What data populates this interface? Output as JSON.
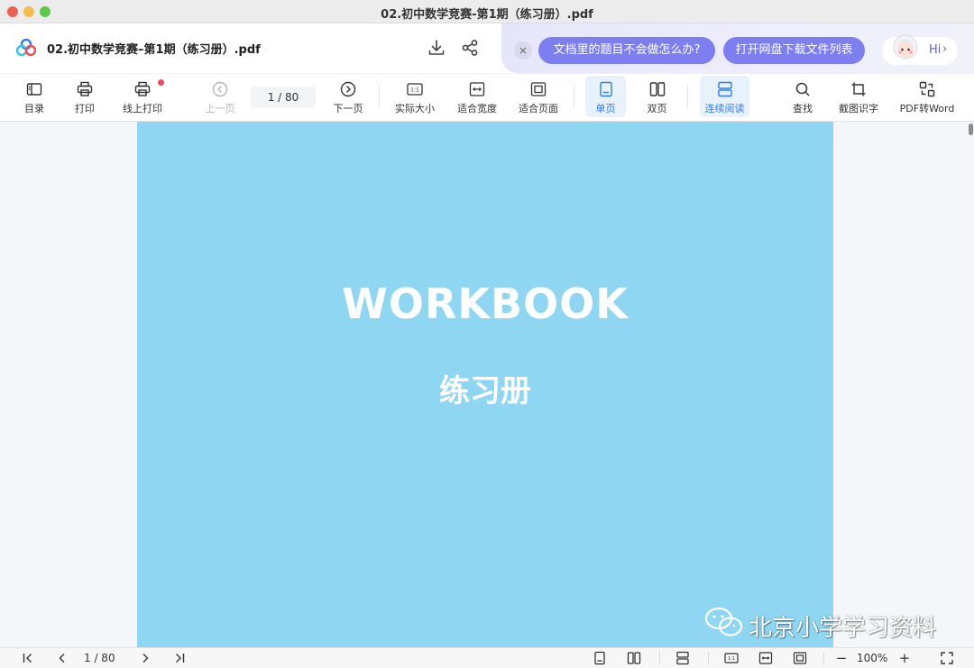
{
  "window": {
    "title": "02.初中数学竞赛-第1期（练习册）.pdf"
  },
  "header": {
    "doc_title": "02.初中数学竞赛–第1期（练习册）.pdf",
    "promo_1": "文档里的题目不会做怎么办?",
    "promo_2": "打开网盘下载文件列表",
    "hi": "Hi",
    "close": "×"
  },
  "toolbar": {
    "toc": "目录",
    "print": "打印",
    "online_print": "线上打印",
    "prev_page": "上一页",
    "page_current": "1",
    "page_total": "80",
    "page_display": "1  / 80",
    "next_page": "下一页",
    "actual_size": "实际大小",
    "fit_width": "适合宽度",
    "fit_page": "适合页面",
    "single_page": "单页",
    "double_page": "双页",
    "continuous": "连续阅读",
    "find": "查找",
    "ocr": "截图识字",
    "pdf_to_word": "PDF转Word"
  },
  "document": {
    "title_en": "WORKBOOK",
    "title_cn": "练习册",
    "page_color": "#8fd6f3"
  },
  "watermark": {
    "text": "北京小学学习资料"
  },
  "bottom": {
    "page_display": "1 / 80",
    "zoom": "100%",
    "zoom_out": "−",
    "zoom_in": "+"
  },
  "colors": {
    "accent": "#2e7cf6",
    "promo": "#7d7ff0"
  }
}
